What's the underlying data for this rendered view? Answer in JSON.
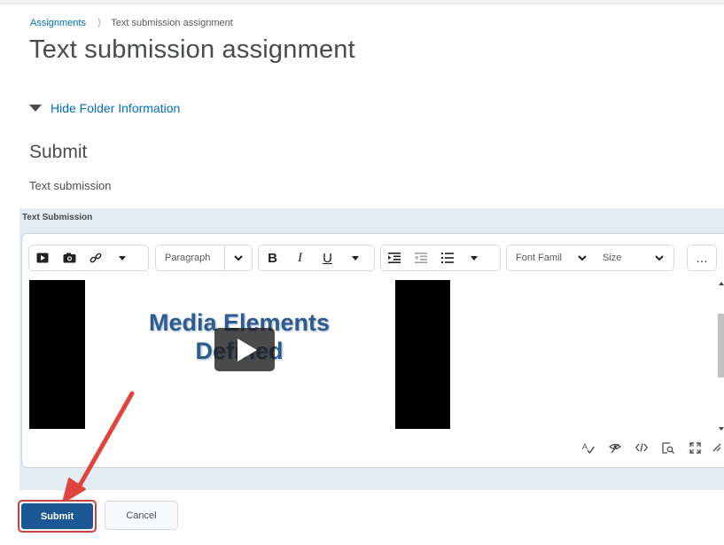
{
  "breadcrumb": {
    "parent": "Assignments",
    "current": "Text submission assignment"
  },
  "page": {
    "title": "Text submission assignment"
  },
  "folder_toggle": {
    "label": "Hide Folder Information"
  },
  "submit_section": {
    "title": "Submit",
    "subtitle": "Text submission"
  },
  "editor": {
    "label": "Text Submission",
    "toolbar": {
      "paragraph_label": "Paragraph",
      "font_family_label": "Font Famil",
      "size_label": "Size",
      "bold": "B",
      "italic": "I",
      "underline": "U",
      "more": "…"
    },
    "content": {
      "video_text_line1": "Media Elements",
      "video_text_line2": "Defined"
    }
  },
  "actions": {
    "submit_label": "Submit",
    "cancel_label": "Cancel"
  },
  "colors": {
    "link": "#006fbf",
    "primary_button": "#1a5794",
    "annotation_arrow": "#e0443e",
    "editor_panel_bg": "#e3ebf3"
  }
}
